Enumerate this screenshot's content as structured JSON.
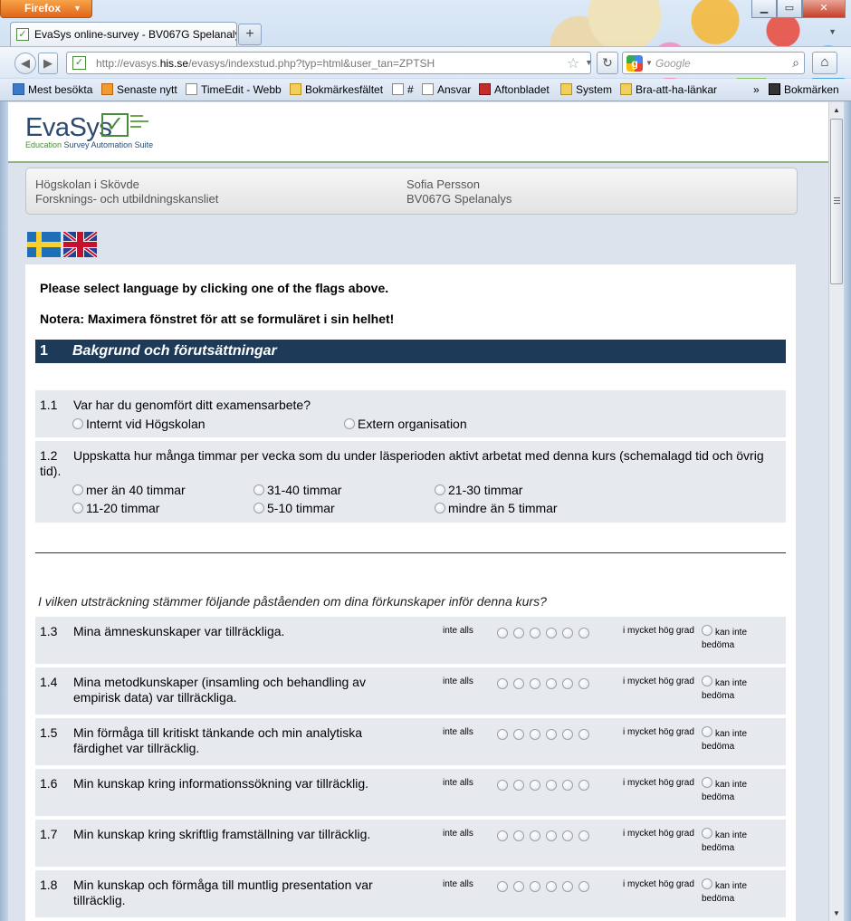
{
  "browser": {
    "app_button": "Firefox",
    "tab_title": "EvaSys online-survey - BV067G Spelanalys",
    "new_tab": "+",
    "url_prefix": "http://evasys.",
    "url_domain": "his.se",
    "url_suffix": "/evasys/indexstud.php?typ=html&user_tan=ZPTSH",
    "search_placeholder": "Google",
    "window_controls": {
      "minimize": "▁",
      "maximize": "▭",
      "close": "✕"
    },
    "bookmarks": [
      {
        "label": "Mest besökta",
        "icon": "blue"
      },
      {
        "label": "Senaste nytt",
        "icon": "rss"
      },
      {
        "label": "TimeEdit - Webb",
        "icon": "page"
      },
      {
        "label": "Bokmärkesfältet",
        "icon": "folder"
      },
      {
        "label": "#",
        "icon": "page"
      },
      {
        "label": "Ansvar",
        "icon": "page"
      },
      {
        "label": "Aftonbladet",
        "icon": "ab"
      },
      {
        "label": "System",
        "icon": "folder"
      },
      {
        "label": "Bra-att-ha-länkar",
        "icon": "folder"
      },
      {
        "label": "»",
        "icon": "none"
      },
      {
        "label": "Bokmärken",
        "icon": "bmk"
      }
    ]
  },
  "logo": {
    "name": "EvaSys",
    "subtitle_a": "Education ",
    "subtitle_b": "Survey Automation Suite"
  },
  "info": {
    "institution": "Högskolan i Skövde",
    "department": "Forsknings- och utbildningskansliet",
    "person": "Sofia Persson",
    "course": "BV067G Spelanalys"
  },
  "notes": {
    "language": "Please select language by clicking one of the flags above.",
    "maximize": "Notera: Maximera fönstret för att se formuläret i sin helhet!"
  },
  "section": {
    "number": "1",
    "title": "Bakgrund och förutsättningar"
  },
  "q11": {
    "number": "1.1",
    "text": "Var har du genomfört ditt examensarbete?",
    "options": [
      "Internt vid Högskolan",
      "Extern organisation"
    ]
  },
  "q12": {
    "number": "1.2",
    "text_line1": "Uppskatta hur många timmar per vecka som du under läsperioden aktivt arbetat med denna kurs (schemalagd tid och övrig",
    "text_line2": "tid).",
    "options": [
      "mer än 40 timmar",
      "31-40 timmar",
      "21-30 timmar",
      "11-20 timmar",
      "5-10 timmar",
      "mindre än 5 timmar"
    ]
  },
  "likert_intro": "I vilken utsträckning stämmer följande påståenden om dina förkunskaper inför denna kurs?",
  "scale": {
    "low": "inte alls",
    "high": "i mycket hög grad",
    "na_line1": "kan inte",
    "na_line2": "bedöma"
  },
  "likert_items": [
    {
      "number": "1.3",
      "text": "Mina ämneskunskaper var tillräckliga."
    },
    {
      "number": "1.4",
      "text": "Mina metodkunskaper (insamling och behandling av empirisk data) var tillräckliga."
    },
    {
      "number": "1.5",
      "text": "Min förmåga till kritiskt tänkande och min analytiska färdighet var tillräcklig."
    },
    {
      "number": "1.6",
      "text": "Min kunskap kring informationssökning var tillräcklig."
    },
    {
      "number": "1.7",
      "text": "Min kunskap kring skriftlig framställning var tillräcklig."
    },
    {
      "number": "1.8",
      "text": "Min kunskap och förmåga till muntlig presentation var tillräcklig."
    }
  ]
}
